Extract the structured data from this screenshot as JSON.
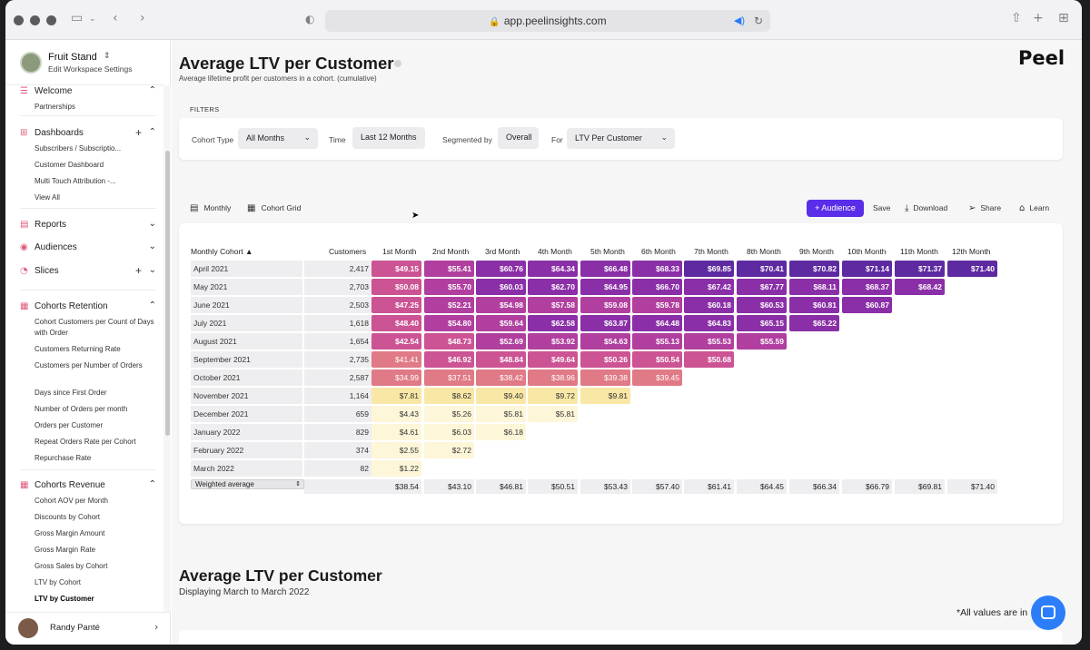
{
  "browser": {
    "url": "app.peelinsights.com"
  },
  "sidebar": {
    "workspace_name": "Fruit Stand",
    "workspace_sub": "Edit Workspace Settings",
    "sections": [
      {
        "label": "Welcome",
        "icon": "☰",
        "plus": false,
        "open": true,
        "items": [
          "Partnerships"
        ]
      },
      {
        "label": "Dashboards",
        "icon": "⊞",
        "plus": true,
        "open": true,
        "items": [
          "Subscribers / Subscriptio...",
          "Customer Dashboard",
          "Multi Touch Attribution -...",
          "View All"
        ]
      },
      {
        "label": "Reports",
        "icon": "▤",
        "plus": false,
        "open": false,
        "items": []
      },
      {
        "label": "Audiences",
        "icon": "◉",
        "plus": false,
        "open": false,
        "items": []
      },
      {
        "label": "Slices",
        "icon": "◔",
        "plus": true,
        "open": false,
        "items": []
      },
      {
        "label": "Cohorts Retention",
        "icon": "▦",
        "plus": false,
        "open": true,
        "items": [
          "Cohort Customers per Count of Days with Order",
          "Customers Returning Rate",
          "Customers per Number of Orders",
          "Days since First Order",
          "Number of Orders per month",
          "Orders per Customer",
          "Repeat Orders Rate per Cohort",
          "Repurchase Rate"
        ]
      },
      {
        "label": "Cohorts Revenue",
        "icon": "▦",
        "plus": false,
        "open": true,
        "items": [
          "Cohort AOV per Month",
          "Discounts by Cohort",
          "Gross Margin Amount",
          "Gross Margin Rate",
          "Gross Sales by Cohort",
          "LTV by Cohort",
          "LTV by Customer"
        ]
      }
    ],
    "active_item": "LTV by Customer",
    "user_name": "Randy Panté"
  },
  "header": {
    "title": "Average LTV per Customer",
    "subtitle": "Average lifetime profit per customers in a cohort. (cumulative)",
    "logo": "Peel"
  },
  "filters": {
    "section_label": "FILTERS",
    "cohort_type_label": "Cohort Type",
    "cohort_type_value": "All Months",
    "time_label": "Time",
    "time_value": "Last 12 Months",
    "segmented_label": "Segmented by",
    "segmented_value": "Overall",
    "for_label": "For",
    "for_value": "LTV Per Customer"
  },
  "toolbar": {
    "monthly": "Monthly",
    "cohort_grid": "Cohort Grid",
    "audience": "Audience",
    "save": "Save",
    "download": "Download",
    "share": "Share",
    "learn": "Learn"
  },
  "chart_data": {
    "type": "table",
    "headers": [
      "Monthly Cohort ▲",
      "Customers",
      "1st Month",
      "2nd Month",
      "3rd Month",
      "4th Month",
      "5th Month",
      "6th Month",
      "7th Month",
      "8th Month",
      "9th Month",
      "10th Month",
      "11th Month",
      "12th Month"
    ],
    "rows": [
      {
        "cohort": "April 2021",
        "customers": "2,417",
        "values": [
          "$49.15",
          "$55.41",
          "$60.76",
          "$64.34",
          "$66.48",
          "$68.33",
          "$69.85",
          "$70.41",
          "$70.82",
          "$71.14",
          "$71.37",
          "$71.40"
        ]
      },
      {
        "cohort": "May 2021",
        "customers": "2,703",
        "values": [
          "$50.08",
          "$55.70",
          "$60.03",
          "$62.70",
          "$64.95",
          "$66.70",
          "$67.42",
          "$67.77",
          "$68.11",
          "$68.37",
          "$68.42"
        ]
      },
      {
        "cohort": "June 2021",
        "customers": "2,503",
        "values": [
          "$47.25",
          "$52.21",
          "$54.98",
          "$57.58",
          "$59.08",
          "$59.78",
          "$60.18",
          "$60.53",
          "$60.81",
          "$60.87"
        ]
      },
      {
        "cohort": "July 2021",
        "customers": "1,618",
        "values": [
          "$48.40",
          "$54.80",
          "$59.64",
          "$62.58",
          "$63.87",
          "$64.48",
          "$64.83",
          "$65.15",
          "$65.22"
        ]
      },
      {
        "cohort": "August 2021",
        "customers": "1,654",
        "values": [
          "$42.54",
          "$48.73",
          "$52.69",
          "$53.92",
          "$54.63",
          "$55.13",
          "$55.53",
          "$55.59"
        ]
      },
      {
        "cohort": "September 2021",
        "customers": "2,735",
        "values": [
          "$41.41",
          "$46.92",
          "$48.84",
          "$49.64",
          "$50.26",
          "$50.54",
          "$50.68"
        ]
      },
      {
        "cohort": "October 2021",
        "customers": "2,587",
        "values": [
          "$34.99",
          "$37.51",
          "$38.42",
          "$38.96",
          "$39.38",
          "$39.45"
        ]
      },
      {
        "cohort": "November 2021",
        "customers": "1,164",
        "values": [
          "$7.81",
          "$8.62",
          "$9.40",
          "$9.72",
          "$9.81"
        ]
      },
      {
        "cohort": "December 2021",
        "customers": "659",
        "values": [
          "$4.43",
          "$5.26",
          "$5.81",
          "$5.81"
        ]
      },
      {
        "cohort": "January 2022",
        "customers": "829",
        "values": [
          "$4.61",
          "$6.03",
          "$6.18"
        ]
      },
      {
        "cohort": "February 2022",
        "customers": "374",
        "values": [
          "$2.55",
          "$2.72"
        ]
      },
      {
        "cohort": "March 2022",
        "customers": "82",
        "values": [
          "$1.22"
        ]
      }
    ],
    "summary_label": "Weighted average",
    "summary_values": [
      "$38.54",
      "$43.10",
      "$46.81",
      "$50.51",
      "$53.43",
      "$57.40",
      "$61.41",
      "$64.45",
      "$66.34",
      "$66.79",
      "$69.81",
      "$71.40"
    ],
    "color_scale": [
      "#fdf6d8",
      "#f9e7a6",
      "#f4cf93",
      "#eda783",
      "#e07a86",
      "#cc5394",
      "#b13f9f",
      "#8a2fa7",
      "#5e2aa1"
    ]
  },
  "section2": {
    "title": "Average LTV per Customer",
    "subtitle": "Displaying March to March 2022",
    "note": "*All values are in"
  },
  "colors": {
    "accent": "#5a2ee8",
    "chat": "#2b7ef8"
  }
}
